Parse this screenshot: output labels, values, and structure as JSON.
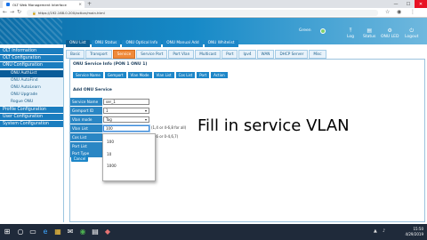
{
  "browser": {
    "tab_title": "OLT Web Management Interface",
    "address": "https://192.168.0.200/action/main.html",
    "back": "←",
    "forward": "→",
    "reload": "↻",
    "minimize": "—",
    "maximize": "☐",
    "close": "✕"
  },
  "header": {
    "user": "Green",
    "links": [
      {
        "icon": "⤒",
        "label": "Log"
      },
      {
        "icon": "▤",
        "label": "Status"
      },
      {
        "icon": "⚙",
        "label": "ONU LED"
      },
      {
        "icon": "⏻",
        "label": "Logout"
      }
    ]
  },
  "sidebar": {
    "items": [
      {
        "label": "OLT Information",
        "kind": "top"
      },
      {
        "label": "OLT Configuration",
        "kind": "top"
      },
      {
        "label": "ONU Configuration",
        "kind": "top"
      },
      {
        "label": "ONU AuthList",
        "kind": "sub-active"
      },
      {
        "label": "ONU AutoFind",
        "kind": "sub"
      },
      {
        "label": "ONU AutoLearn",
        "kind": "sub"
      },
      {
        "label": "ONU Upgrade",
        "kind": "sub"
      },
      {
        "label": "Rogue ONU",
        "kind": "sub"
      },
      {
        "label": "Profile Configuration",
        "kind": "top"
      },
      {
        "label": "User Configuration",
        "kind": "top"
      },
      {
        "label": "System Configuration",
        "kind": "top"
      }
    ]
  },
  "menutabs": [
    "ONU List",
    "ONU Status",
    "ONU Optical Info",
    "ONU Manual Add",
    "ONU Whitelist"
  ],
  "subtabs": [
    "Basic",
    "Transport",
    "Service",
    "Service Port",
    "Port Vlan",
    "Multicast",
    "Port",
    "Ipv4",
    "WAN",
    "DHCP Server",
    "Misc"
  ],
  "section_title": "ONU Service Info (PON 1 ONU 1)",
  "minitabs": [
    "Service Name",
    "Gemport",
    "Vlan Mode",
    "Vlan List",
    "Cos List",
    "Port",
    "Action"
  ],
  "add_title": "Add ONU Service",
  "form": {
    "service_name": {
      "label": "Service Name",
      "value": "ser_1"
    },
    "gemport_id": {
      "label": "Gemport ID",
      "value": "1"
    },
    "vlan_mode": {
      "label": "Vlan mode",
      "value": "Tag"
    },
    "vlan_list": {
      "label": "Vlan List",
      "value": "100",
      "hint": "(1,4 or 4-6,8 for all)"
    },
    "cos_list": {
      "label": "Cos List",
      "hint": "(0,6 or 0-4,6,7)"
    },
    "port_list": {
      "label": "Port List"
    },
    "port_type": {
      "label": "Port Type"
    }
  },
  "cancel_label": "Cancel",
  "dropdown_options": [
    "100",
    "10",
    "1000"
  ],
  "overlay_text": "Fill in service VLAN",
  "taskbar": {
    "start": "⊞",
    "icons": [
      "○",
      "▭",
      "e",
      "▦",
      "✉",
      "◉",
      "▤",
      "◆"
    ],
    "time": "15:50",
    "date": "4/29/2019"
  }
}
